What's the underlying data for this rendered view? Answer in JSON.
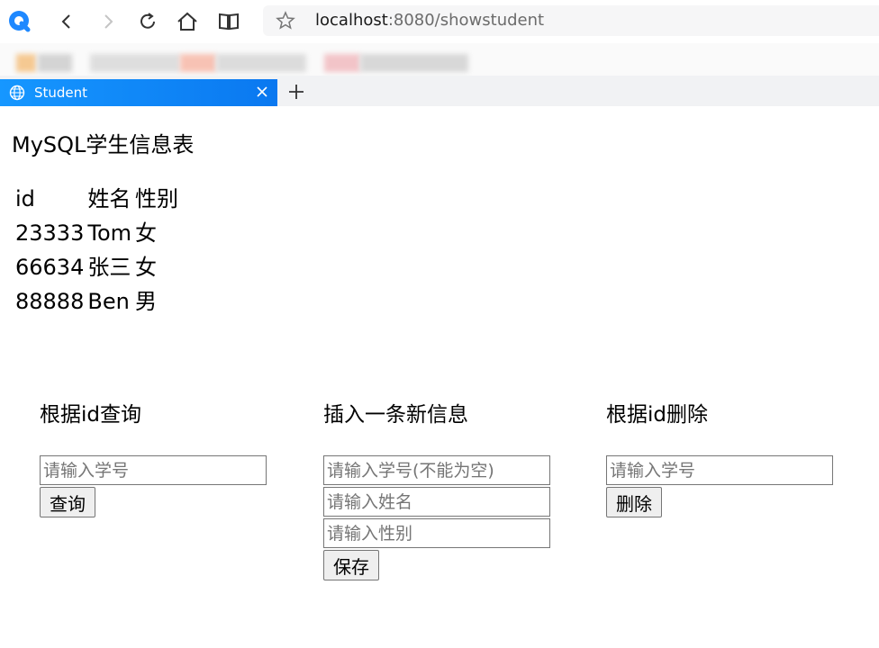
{
  "browser": {
    "url_host": "localhost",
    "url_path": ":8080/showstudent",
    "tab_title": "Student"
  },
  "page": {
    "title": "MySQL学生信息表"
  },
  "table": {
    "headers": [
      "id",
      "姓名",
      "性别"
    ],
    "rows": [
      [
        "23333",
        "Tom",
        "女"
      ],
      [
        "66634",
        "张三",
        "女"
      ],
      [
        "88888",
        "Ben",
        "男"
      ]
    ]
  },
  "query": {
    "heading": "根据id查询",
    "id_placeholder": "请输入学号",
    "button_label": "查询"
  },
  "insert": {
    "heading": "插入一条新信息",
    "id_placeholder": "请输入学号(不能为空)",
    "name_placeholder": "请输入姓名",
    "gender_placeholder": "请输入性别",
    "button_label": "保存"
  },
  "delete": {
    "heading": "根据id删除",
    "id_placeholder": "请输入学号",
    "button_label": "删除"
  },
  "colors": {
    "tab_accent": "#0a78f0",
    "logo": "#1e88ff"
  }
}
